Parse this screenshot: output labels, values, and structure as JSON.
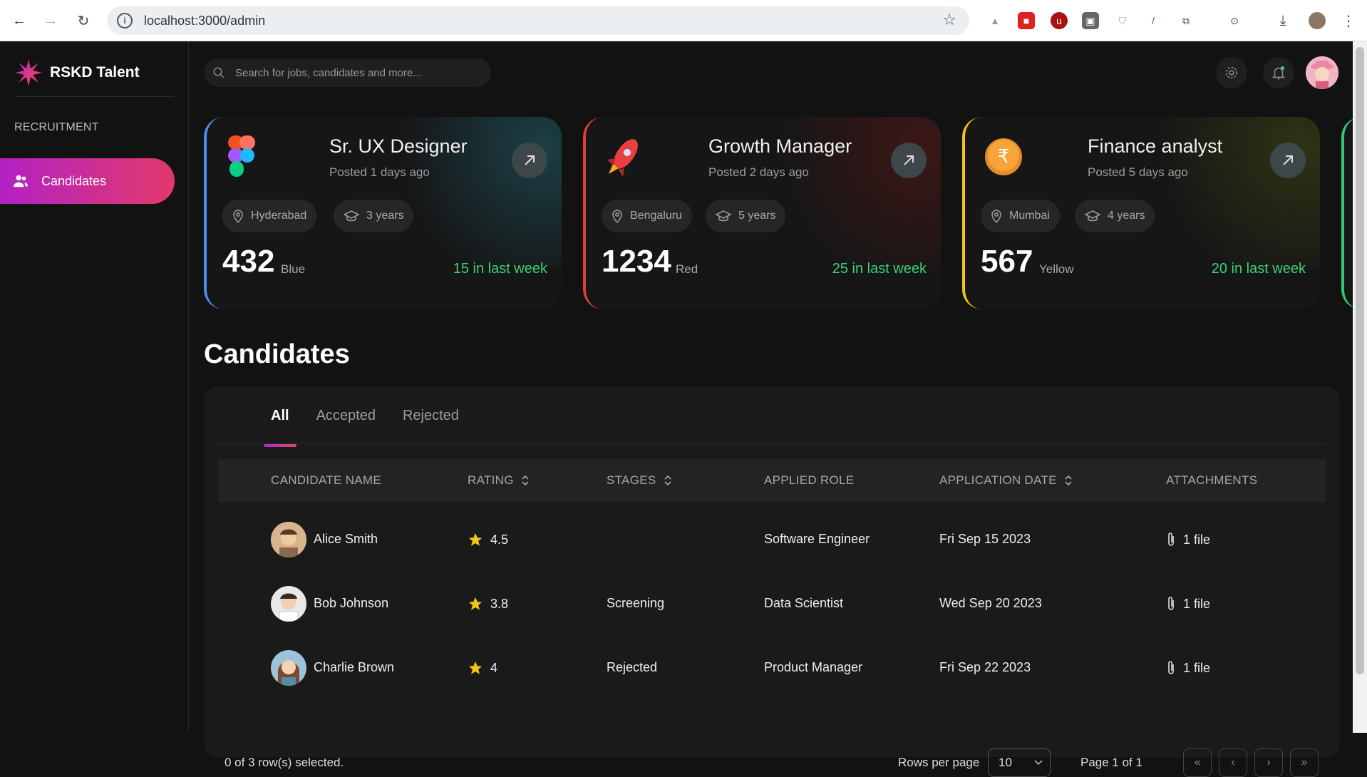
{
  "browser": {
    "url": "localhost:3000/admin",
    "back_icon": "arrow-left-icon",
    "forward_icon": "arrow-right-icon",
    "reload_icon": "reload-icon"
  },
  "brand": {
    "name": "RSKD Talent",
    "logo_icon": "starburst-logo-icon"
  },
  "sidebar": {
    "section": "RECRUITMENT",
    "items": [
      {
        "label": "Candidates",
        "icon": "users-icon",
        "active": true
      }
    ]
  },
  "search": {
    "placeholder": "Search for jobs, candidates and more..."
  },
  "jobs": [
    {
      "title": "Sr. UX Designer",
      "posted": "Posted 1 days ago",
      "location": "Hyderabad",
      "experience": "3 years",
      "count": "432",
      "color_name": "Blue",
      "last_week": "15 in last week",
      "accent": "#4d8cf5",
      "glow": "#1b3f46"
    },
    {
      "title": "Growth Manager",
      "posted": "Posted 2 days ago",
      "location": "Bengaluru",
      "experience": "5 years",
      "count": "1234",
      "color_name": "Red",
      "last_week": "25 in last week",
      "accent": "#e23c3c",
      "glow": "#3d1717"
    },
    {
      "title": "Finance analyst",
      "posted": "Posted 5 days ago",
      "location": "Mumbai",
      "experience": "4 years",
      "count": "567",
      "color_name": "Yellow",
      "last_week": "20 in last week",
      "accent": "#f2c418",
      "glow": "#2e3314"
    }
  ],
  "candidates_section": {
    "title": "Candidates",
    "tabs": [
      "All",
      "Accepted",
      "Rejected"
    ],
    "active_tab": "All",
    "columns": [
      "CANDIDATE NAME",
      "RATING",
      "STAGES",
      "APPLIED ROLE",
      "APPLICATION DATE",
      "ATTACHMENTS"
    ],
    "rows": [
      {
        "name": "Alice Smith",
        "rating": "4.5",
        "stage": "",
        "role": "Software Engineer",
        "date": "Fri Sep 15 2023",
        "attachments": "1 file"
      },
      {
        "name": "Bob Johnson",
        "rating": "3.8",
        "stage": "Screening",
        "role": "Data Scientist",
        "date": "Wed Sep 20 2023",
        "attachments": "1 file"
      },
      {
        "name": "Charlie Brown",
        "rating": "4",
        "stage": "Rejected",
        "role": "Product Manager",
        "date": "Fri Sep 22 2023",
        "attachments": "1 file"
      }
    ],
    "selection": "0 of 3 row(s) selected.",
    "rows_per_page_label": "Rows per page",
    "rows_per_page": "10",
    "page": "Page 1 of 1"
  },
  "colors": {
    "accent_gradient_start": "#b321c4",
    "accent_gradient_end": "#e23a6c",
    "positive": "#3dd27a",
    "star": "#f5c518"
  }
}
